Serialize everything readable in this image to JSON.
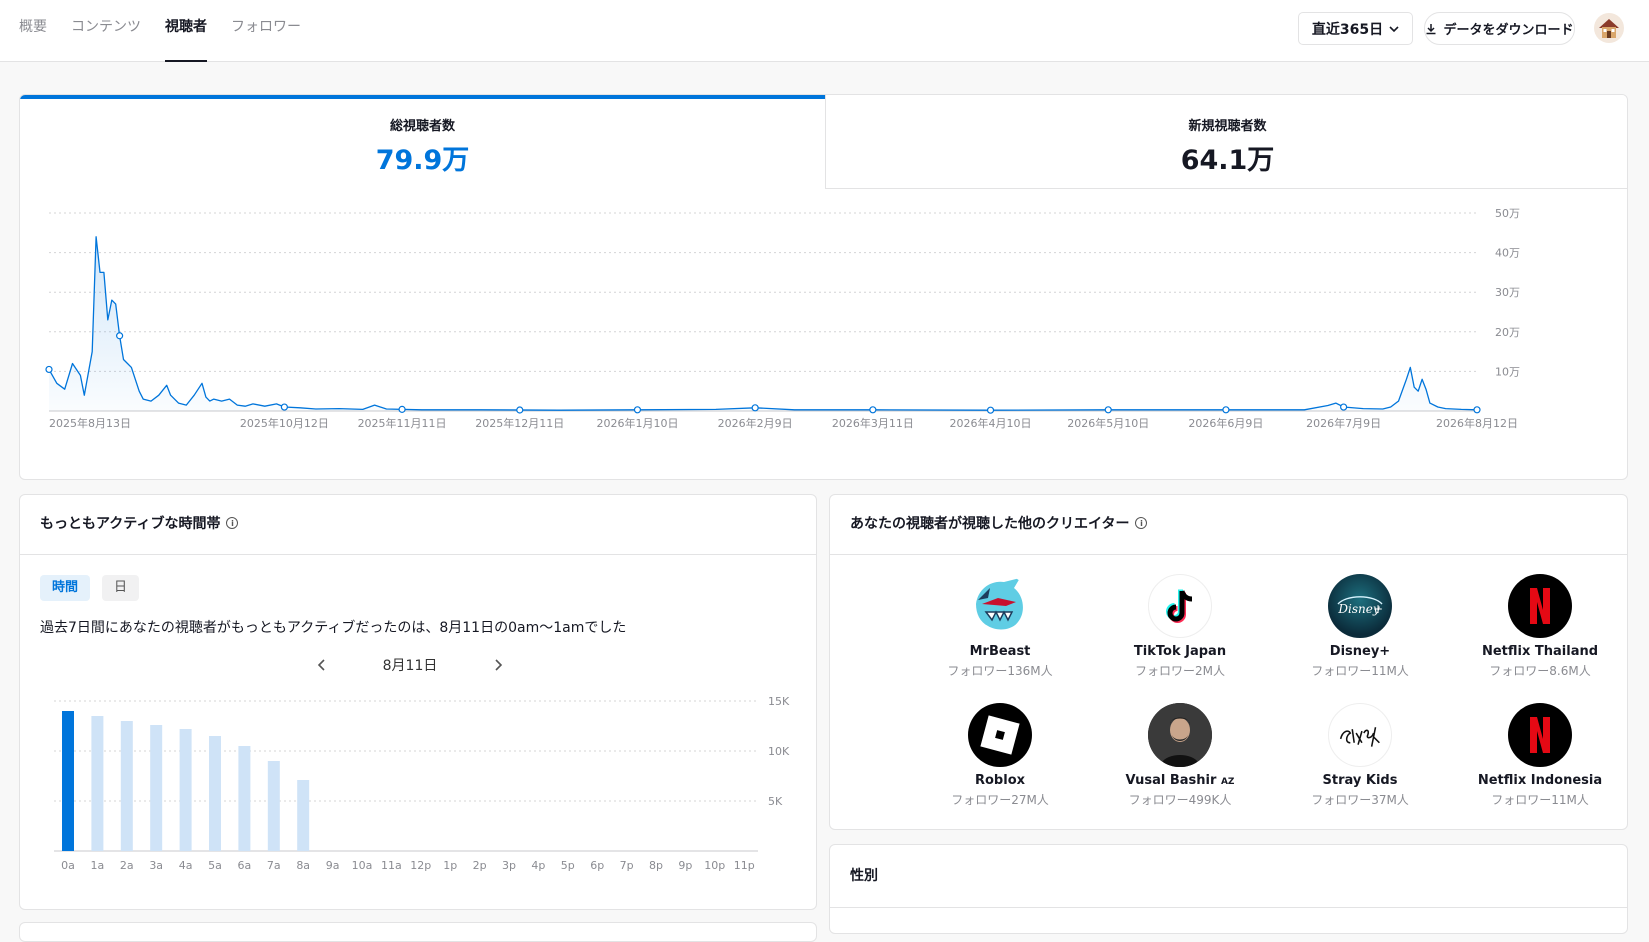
{
  "nav": {
    "tabs": [
      {
        "label": "概要",
        "active": false
      },
      {
        "label": "コンテンツ",
        "active": false
      },
      {
        "label": "視聴者",
        "active": true
      },
      {
        "label": "フォロワー",
        "active": false
      }
    ],
    "range_label": "直近365日",
    "download_label": "データをダウンロード"
  },
  "metrics": {
    "total_label": "総視聴者数",
    "total_value": "79.9万",
    "new_label": "新規視聴者数",
    "new_value": "64.1万"
  },
  "colors": {
    "accent": "#0075db",
    "light_bar": "#cfe3f7",
    "text": "#161823",
    "muted": "#8a8b91"
  },
  "chart_data": [
    {
      "type": "line",
      "y_tick_labels": [
        "10万",
        "20万",
        "30万",
        "40万",
        "50万"
      ],
      "ylim": [
        0,
        500000
      ],
      "x_tick_labels": [
        "2025年8月13日",
        "2025年10月12日",
        "2025年11月11日",
        "2025年12月11日",
        "2026年1月10日",
        "2026年2月9日",
        "2026年3月11日",
        "2026年4月10日",
        "2026年5月10日",
        "2026年6月9日",
        "2026年7月9日",
        "2026年8月12日"
      ],
      "x_tick_days": [
        0,
        60,
        90,
        120,
        150,
        180,
        210,
        240,
        270,
        300,
        330,
        364
      ],
      "series": [
        {
          "points": [
            [
              0,
              105000
            ],
            [
              2,
              70000
            ],
            [
              4,
              55000
            ],
            [
              6,
              120000
            ],
            [
              8,
              90000
            ],
            [
              9,
              40000
            ],
            [
              11,
              150000
            ],
            [
              12,
              440000
            ],
            [
              13,
              350000
            ],
            [
              14,
              350000
            ],
            [
              15,
              230000
            ],
            [
              16,
              280000
            ],
            [
              17,
              270000
            ],
            [
              18,
              190000
            ],
            [
              19,
              130000
            ],
            [
              20,
              120000
            ],
            [
              21,
              110000
            ],
            [
              22,
              80000
            ],
            [
              23,
              50000
            ],
            [
              24,
              30000
            ],
            [
              26,
              25000
            ],
            [
              28,
              40000
            ],
            [
              30,
              65000
            ],
            [
              31,
              40000
            ],
            [
              32,
              30000
            ],
            [
              33,
              20000
            ],
            [
              35,
              15000
            ],
            [
              37,
              40000
            ],
            [
              39,
              70000
            ],
            [
              40,
              35000
            ],
            [
              41,
              25000
            ],
            [
              42,
              30000
            ],
            [
              44,
              25000
            ],
            [
              46,
              30000
            ],
            [
              48,
              15000
            ],
            [
              50,
              12000
            ],
            [
              52,
              18000
            ],
            [
              55,
              12000
            ],
            [
              58,
              18000
            ],
            [
              60,
              10000
            ],
            [
              64,
              8000
            ],
            [
              68,
              5000
            ],
            [
              74,
              6000
            ],
            [
              80,
              4000
            ],
            [
              83,
              15000
            ],
            [
              86,
              5000
            ],
            [
              95,
              3000
            ],
            [
              110,
              3000
            ],
            [
              130,
              2000
            ],
            [
              150,
              3000
            ],
            [
              170,
              4000
            ],
            [
              180,
              8000
            ],
            [
              190,
              3000
            ],
            [
              210,
              3000
            ],
            [
              240,
              2000
            ],
            [
              270,
              3000
            ],
            [
              300,
              3000
            ],
            [
              320,
              3000
            ],
            [
              326,
              14000
            ],
            [
              328,
              20000
            ],
            [
              330,
              10000
            ],
            [
              335,
              6000
            ],
            [
              340,
              5000
            ],
            [
              342,
              10000
            ],
            [
              344,
              25000
            ],
            [
              346,
              80000
            ],
            [
              347,
              110000
            ],
            [
              348,
              60000
            ],
            [
              349,
              50000
            ],
            [
              350,
              80000
            ],
            [
              351,
              55000
            ],
            [
              352,
              20000
            ],
            [
              354,
              10000
            ],
            [
              356,
              6000
            ],
            [
              360,
              4000
            ],
            [
              364,
              3000
            ]
          ]
        }
      ]
    },
    {
      "type": "bar",
      "categories": [
        "0a",
        "1a",
        "2a",
        "3a",
        "4a",
        "5a",
        "6a",
        "7a",
        "8a",
        "9a",
        "10a",
        "11a",
        "12p",
        "1p",
        "2p",
        "3p",
        "4p",
        "5p",
        "6p",
        "7p",
        "8p",
        "9p",
        "10p",
        "11p"
      ],
      "values": [
        14000,
        13500,
        13000,
        12600,
        12200,
        11500,
        10500,
        9000,
        7100,
        0,
        0,
        0,
        0,
        0,
        0,
        0,
        0,
        0,
        0,
        0,
        0,
        0,
        0,
        0
      ],
      "highlight_index": 0,
      "y_tick_labels": [
        "5K",
        "10K",
        "15K"
      ],
      "ylim": [
        0,
        15000
      ]
    }
  ],
  "active": {
    "title": "もっともアクティブな時間帯",
    "toggle_hour": "時間",
    "toggle_day": "日",
    "summary": "過去7日間にあなたの視聴者がもっともアクティブだったのは、8月11日の0am〜1amでした",
    "date_label": "8月11日"
  },
  "creators": {
    "title": "あなたの視聴者が視聴した他のクリエイター",
    "items": [
      {
        "name": "MrBeast",
        "badge": "",
        "followers": "フォロワー136M人",
        "icon": "mrbeast-logo"
      },
      {
        "name": "TikTok Japan",
        "badge": "",
        "followers": "フォロワー2M人",
        "icon": "tiktok-logo"
      },
      {
        "name": "Disney+",
        "badge": "",
        "followers": "フォロワー11M人",
        "icon": "disney-plus-logo"
      },
      {
        "name": "Netflix Thailand",
        "badge": "",
        "followers": "フォロワー8.6M人",
        "icon": "netflix-logo"
      },
      {
        "name": "Roblox",
        "badge": "",
        "followers": "フォロワー27M人",
        "icon": "roblox-logo"
      },
      {
        "name": "Vusal Bashir",
        "badge": "AZ",
        "followers": "フォロワー499K人",
        "icon": "person-avatar"
      },
      {
        "name": "Stray Kids",
        "badge": "",
        "followers": "フォロワー37M人",
        "icon": "stray-kids-logo"
      },
      {
        "name": "Netflix Indonesia",
        "badge": "",
        "followers": "フォロワー11M人",
        "icon": "netflix-logo"
      }
    ]
  },
  "gender": {
    "title": "性別"
  }
}
